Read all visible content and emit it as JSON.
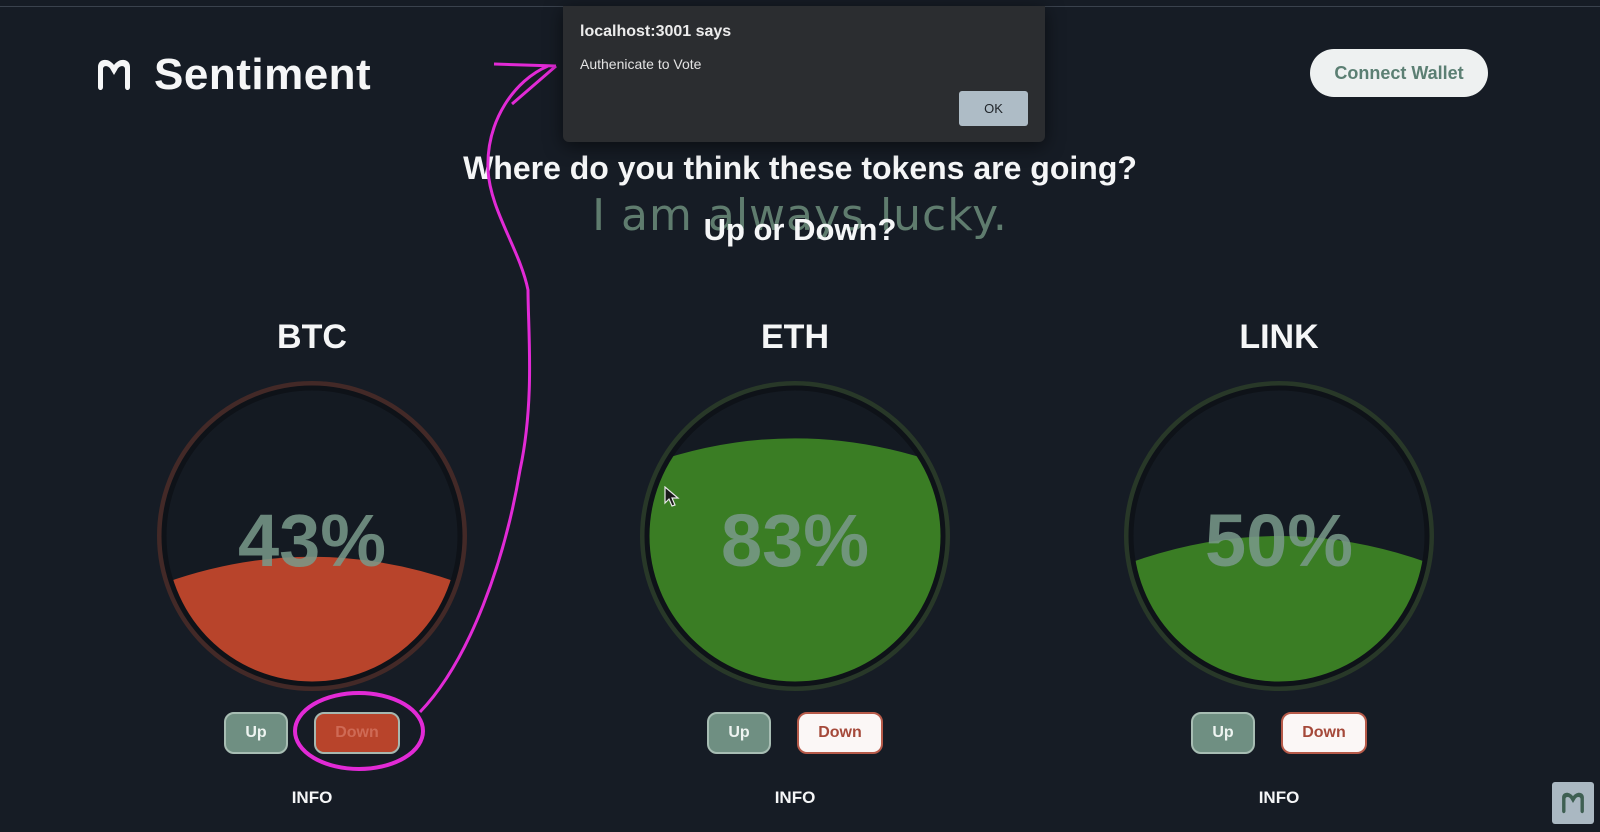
{
  "app": {
    "name": "Sentiment",
    "logo_icon": "m-logo-icon"
  },
  "header": {
    "connect_label": "Connect Wallet"
  },
  "headline": {
    "question": "Where do you think these tokens are going?",
    "subtitle": "Up or Down?",
    "overlay_text": "I am always lucky."
  },
  "tokens": [
    {
      "symbol": "BTC",
      "percent": "43%",
      "fill_fraction": 0.43,
      "fill_color": "#b8442b",
      "ring_color": "#7a3a2a",
      "up_label": "Up",
      "down_label": "Down",
      "info_label": "INFO"
    },
    {
      "symbol": "ETH",
      "percent": "83%",
      "fill_fraction": 0.83,
      "fill_color": "#3a7d24",
      "ring_color": "#3d5a2c",
      "up_label": "Up",
      "down_label": "Down",
      "info_label": "INFO"
    },
    {
      "symbol": "LINK",
      "percent": "50%",
      "fill_fraction": 0.5,
      "fill_color": "#3a7d24",
      "ring_color": "#3d5a2c",
      "up_label": "Up",
      "down_label": "Down",
      "info_label": "INFO"
    }
  ],
  "alert": {
    "title": "localhost:3001 says",
    "message": "Authenicate to Vote",
    "ok_label": "OK"
  },
  "colors": {
    "background": "#161c25",
    "annotation": "#e22ad6",
    "up_button": "#6f8f82",
    "down_button_pressed": "#b8442b"
  }
}
